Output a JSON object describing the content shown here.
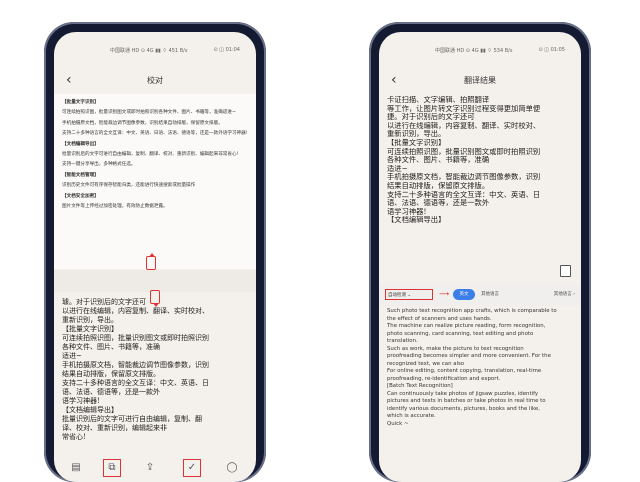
{
  "left": {
    "status": {
      "carrier": "中国联通 HD ⊙ 4G ▮▮ ⌔ 451 B/s",
      "right": "⊙ ◫ 01:04"
    },
    "header": {
      "back": "‹",
      "title": "校对"
    },
    "doc": [
      {
        "t": "【批量文字识别】",
        "b": true
      },
      {
        "t": "可连续拍照识图，批量识别图文或即时拍照识别各种文件、图片、书籍等，准确适进~",
        "b": false
      },
      {
        "t": "手机拍摄原文档，智能裁边调节图像参数，识别结果自动排版，保留原文排版。",
        "b": false
      },
      {
        "t": "支持二十多种语言的全文互译：中文、英语、日语、法语、德语等，还是一款外语学习神器!",
        "b": false
      },
      {
        "t": "【文档编辑导出】",
        "b": true
      },
      {
        "t": "批量识别后的文字可进行自由编辑，复制、翻译、校对、重新识别、编辑起来非常省心!",
        "b": false
      },
      {
        "t": "支持一键分享导出，多种格式任选。",
        "b": false
      },
      {
        "t": "【智能文档管理】",
        "b": true
      },
      {
        "t": "识别历史文件可有序保存智能归类，还能进行快速搜索或批量操作",
        "b": false
      },
      {
        "t": "【文档安全加密】",
        "b": true
      },
      {
        "t": "图片文件等上传经过加密处理，有效防止数据泄露。",
        "b": false
      }
    ],
    "handwriting": [
      "璩。对于识别后的文字还可",
      "以进行在线编辑，内容复制、翻译、实时校对、",
      "重新识别，导出。",
      "【批量文字识别】",
      "可连续拍照识图，批量识别图文或即时拍照识别",
      "各种文件、图片、书籍等，准确",
      "适进~",
      "手机拍摄原文档，智能裁边调节图像参数，识别",
      "结果自动排版，保留原文排版。",
      "支持二十多种语言的全文互译：中文、英语、日",
      "语、法语、德语等，还是一款外",
      "语学习神器!",
      "【文档编辑导出】",
      "批量识别后的文字可进行自由编辑，复制、翻",
      "译、校对、重新识别，编辑起来非",
      "常省心!"
    ],
    "toolbar": [
      "▤",
      "⧉",
      "⇪",
      "✓",
      "◯"
    ]
  },
  "right": {
    "status": {
      "carrier": "中国联通 HD ⊙ 4G ▮▮ ⌔ 534 B/s",
      "right": "⊙ ◫ 01:05"
    },
    "header": {
      "back": "‹",
      "title": "翻译结果"
    },
    "handwriting": [
      "卡证扫描、文字编辑、拍照翻译",
      "等工作，让图片转文字识别过程变得更加简单便",
      "捷。对于识别后的文字还可",
      "以进行在线编辑，内容复制、翻译、实时校对、",
      "重新识别，导出。",
      "【批量文字识别】",
      "可连续拍照识图，批量识别图文或即时拍照识别",
      "各种文件、图片、书籍等，准确",
      "适进~",
      "手机拍摄原文档，智能裁边调节图像参数，识别",
      "结果自动排版，保留原文排版。",
      "支持二十多种语言的全文互译：中文、英语、日",
      "语、法语、德语等，还是一款外",
      "语学习神器!",
      "【文档编辑导出】"
    ],
    "bar": {
      "source": "自动检测 ⌄",
      "swap": "⟶",
      "translate": "英文",
      "other1": "其他语言",
      "other2": "其他语言 ›"
    },
    "translation": [
      "Such photo text recognition app crafts, which is comparable to",
      "the effect of scanners and uses hands.",
      "The machine can realize picture reading, form recognition,",
      "photo scanning, card scanning, text editing and photo",
      "translation.",
      "Such as work, make the picture to text recognition",
      "proofreading becomes simpler and more convenient. For the",
      "recognized text, we can also",
      "For online editing, content copying, translation, real-time",
      "proofreading, re-identification and export.",
      "[Batch Text Recognition]",
      "Can continuously take photos of jigsaw puzzles, identify",
      "pictures and texts in batches or take photos in real time to",
      "identify various documents, pictures, books and the like,",
      "which is accurate.",
      "Quick ~"
    ]
  },
  "colors": {
    "accent_red": "#d33333",
    "translate_blue": "#3a7ee8",
    "frame": "#151a33"
  }
}
